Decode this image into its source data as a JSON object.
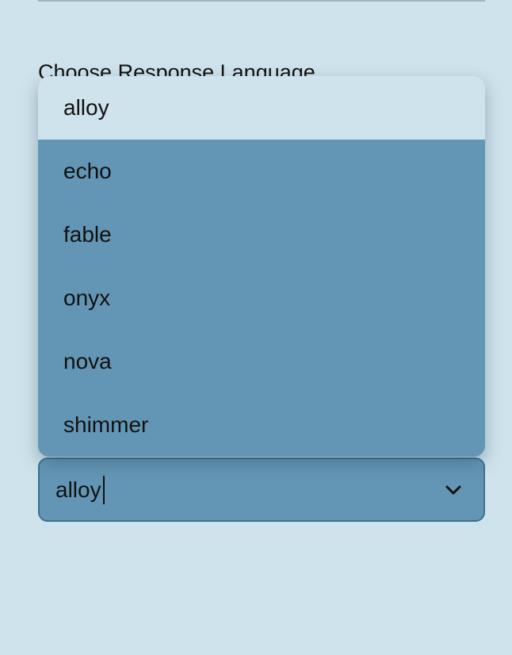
{
  "section": {
    "label": "Choose Response Language"
  },
  "dropdown": {
    "options": [
      "alloy",
      "echo",
      "fable",
      "onyx",
      "nova",
      "shimmer"
    ],
    "selected_index": 0
  },
  "select": {
    "value": "alloy",
    "icon": "chevron-down-icon"
  },
  "colors": {
    "background": "#cfe3ec",
    "menu": "#6396b5",
    "selected_option": "#cfe3ec",
    "select_border": "#3f6f8e"
  }
}
